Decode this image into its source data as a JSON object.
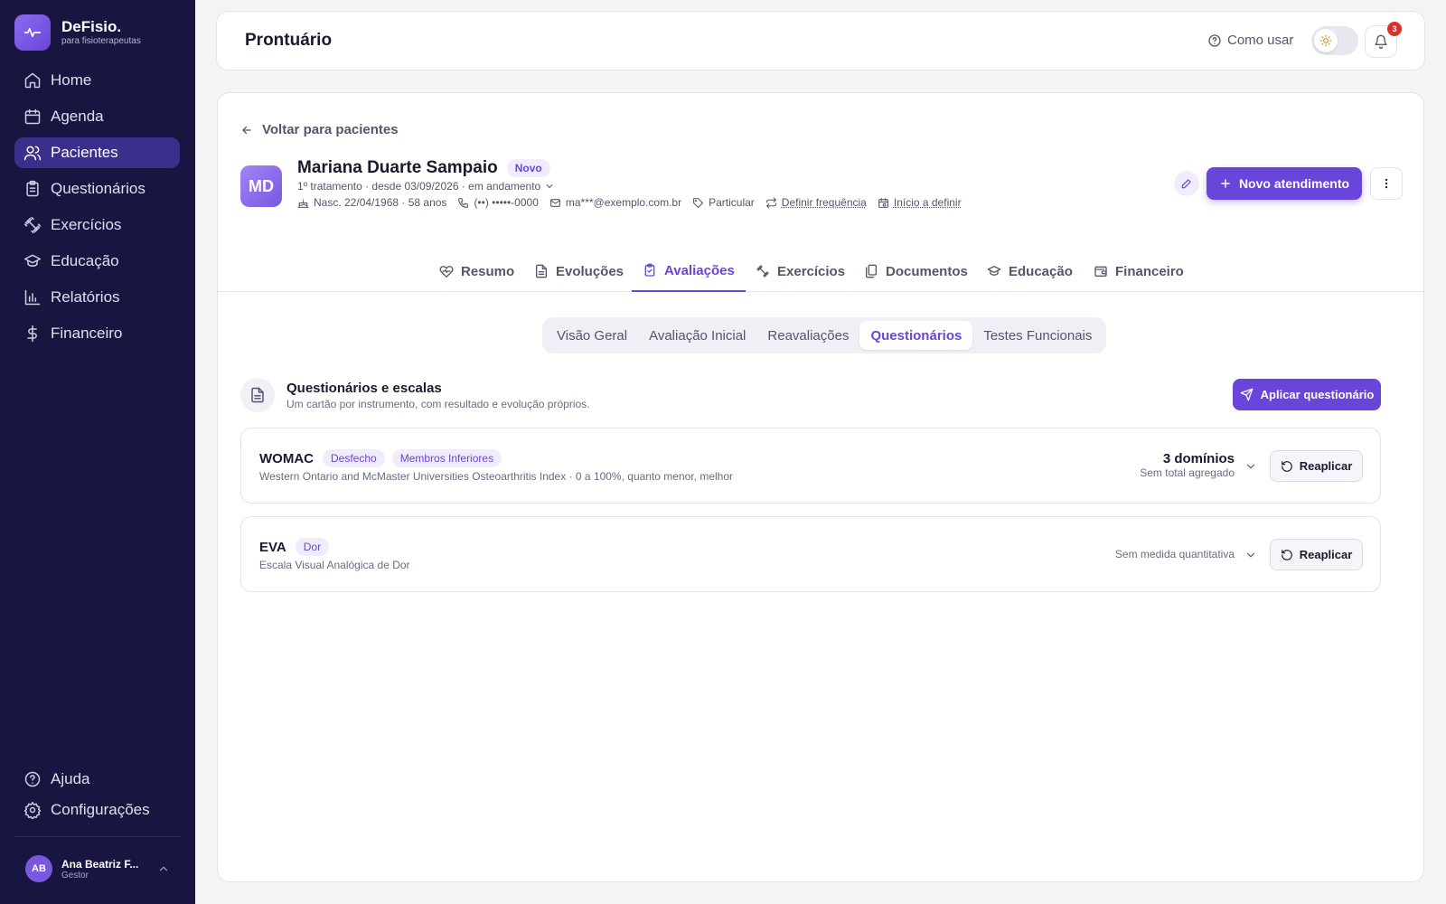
{
  "colors": {
    "accent": "#6a45d9",
    "sidebar_bg": "#181640",
    "notification": "#d93030"
  },
  "brand": {
    "name": "DeFisio.",
    "tagline": "para fisioterapeutas"
  },
  "sidebar": {
    "items": [
      {
        "label": "Home",
        "icon": "home-icon"
      },
      {
        "label": "Agenda",
        "icon": "calendar-icon"
      },
      {
        "label": "Pacientes",
        "icon": "users-icon",
        "active": true
      },
      {
        "label": "Questionários",
        "icon": "clipboard-icon"
      },
      {
        "label": "Exercícios",
        "icon": "dumbbell-icon"
      },
      {
        "label": "Educação",
        "icon": "graduation-cap-icon"
      },
      {
        "label": "Relatórios",
        "icon": "bar-chart-icon"
      },
      {
        "label": "Financeiro",
        "icon": "dollar-icon"
      }
    ],
    "bottom": [
      {
        "label": "Ajuda",
        "icon": "help-icon"
      },
      {
        "label": "Configurações",
        "icon": "gear-icon"
      }
    ],
    "user": {
      "initials": "AB",
      "name": "Ana Beatriz F...",
      "role": "Gestor"
    }
  },
  "header": {
    "title": "Prontuário",
    "help": "Como usar",
    "notifications": "3"
  },
  "patient": {
    "back": "Voltar para pacientes",
    "initials": "MD",
    "name": "Mariana Duarte Sampaio",
    "badge": "Novo",
    "status": "1º tratamento · desde 03/09/2026 · em andamento",
    "birth": "Nasc. 22/04/1968 · 58 anos",
    "phone": "(••) •••••-0000",
    "email": "ma***@exemplo.com.br",
    "plan": "Particular",
    "frequency": "Definir frequência",
    "start": "Início a definir",
    "new_visit": "Novo atendimento"
  },
  "tabs": [
    {
      "label": "Resumo",
      "icon": "heart-pulse-icon"
    },
    {
      "label": "Evoluções",
      "icon": "file-text-icon"
    },
    {
      "label": "Avaliações",
      "icon": "clipboard-check-icon",
      "active": true
    },
    {
      "label": "Exercícios",
      "icon": "dumbbell-icon"
    },
    {
      "label": "Documentos",
      "icon": "files-icon"
    },
    {
      "label": "Educação",
      "icon": "graduation-cap-icon"
    },
    {
      "label": "Financeiro",
      "icon": "wallet-icon"
    }
  ],
  "subtabs": [
    {
      "label": "Visão Geral"
    },
    {
      "label": "Avaliação Inicial"
    },
    {
      "label": "Reavaliações"
    },
    {
      "label": "Questionários",
      "active": true
    },
    {
      "label": "Testes Funcionais"
    }
  ],
  "section": {
    "title": "Questionários e escalas",
    "subtitle": "Um cartão por instrumento, com resultado e evolução próprios.",
    "apply": "Aplicar questionário"
  },
  "questionnaires": [
    {
      "name": "WOMAC",
      "tags": [
        "Desfecho",
        "Membros Inferiores"
      ],
      "description": "Western Ontario and McMaster Universities Osteoarthritis Index · 0 a 100%, quanto menor, melhor",
      "result": "3 domínios",
      "result_sub": "Sem total agregado",
      "reapply": "Reaplicar"
    },
    {
      "name": "EVA",
      "tags": [
        "Dor"
      ],
      "description": "Escala Visual Analógica de Dor",
      "result_sub": "Sem medida quantitativa",
      "reapply": "Reaplicar"
    }
  ]
}
